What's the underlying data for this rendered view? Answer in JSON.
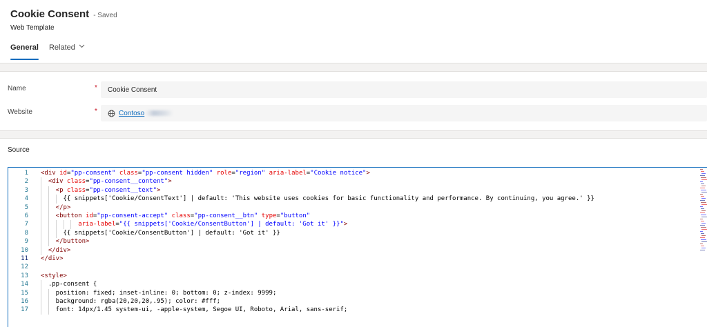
{
  "header": {
    "title": "Cookie Consent",
    "saved": "- Saved",
    "subtitle": "Web Template",
    "tabs": [
      {
        "label": "General",
        "active": true
      },
      {
        "label": "Related",
        "active": false
      }
    ]
  },
  "form": {
    "name_label": "Name",
    "name_value": "Cookie Consent",
    "website_label": "Website",
    "website_value": "Contoso",
    "required_marker": "*"
  },
  "source": {
    "label": "Source",
    "current_line": 11,
    "lines": [
      {
        "n": "1",
        "indent": 0,
        "code": "<div id=\"pp-consent\" class=\"pp-consent hidden\" role=\"region\" aria-label=\"Cookie notice\">"
      },
      {
        "n": "2",
        "indent": 1,
        "code": "<div class=\"pp-consent__content\">"
      },
      {
        "n": "3",
        "indent": 2,
        "code": "<p class=\"pp-consent__text\">"
      },
      {
        "n": "4",
        "indent": 3,
        "code": "{{ snippets['Cookie/ConsentText'] | default: 'This website uses cookies for basic functionality and performance. By continuing, you agree.' }}"
      },
      {
        "n": "5",
        "indent": 2,
        "code": "</p>"
      },
      {
        "n": "6",
        "indent": 2,
        "code": "<button id=\"pp-consent-accept\" class=\"pp-consent__btn\" type=\"button\""
      },
      {
        "n": "7",
        "indent": 5,
        "code": "aria-label=\"{{ snippets['Cookie/ConsentButton'] | default: 'Got it' }}\">"
      },
      {
        "n": "8",
        "indent": 3,
        "code": "{{ snippets['Cookie/ConsentButton'] | default: 'Got it' }}"
      },
      {
        "n": "9",
        "indent": 2,
        "code": "</button>"
      },
      {
        "n": "10",
        "indent": 1,
        "code": "</div>"
      },
      {
        "n": "11",
        "indent": 0,
        "code": "</div>"
      },
      {
        "n": "12",
        "indent": 0,
        "code": ""
      },
      {
        "n": "13",
        "indent": 0,
        "code": "<style>"
      },
      {
        "n": "14",
        "indent": 1,
        "code": ".pp-consent {"
      },
      {
        "n": "15",
        "indent": 2,
        "code": "position: fixed; inset-inline: 0; bottom: 0; z-index: 9999;"
      },
      {
        "n": "16",
        "indent": 2,
        "code": "background: rgba(20,20,20,.95); color: #fff;"
      },
      {
        "n": "17",
        "indent": 2,
        "code": "font: 14px/1.45 system-ui, -apple-system, Segoe UI, Roboto, Arial, sans-serif;"
      }
    ]
  },
  "icons": {
    "website_icon": "globe-icon",
    "related_chevron": "chevron-down-icon"
  },
  "colors": {
    "accent": "#0f6cbd",
    "required": "#c50f1f",
    "tag": "#800000",
    "attribute": "#e50000",
    "string": "#0000ff"
  }
}
